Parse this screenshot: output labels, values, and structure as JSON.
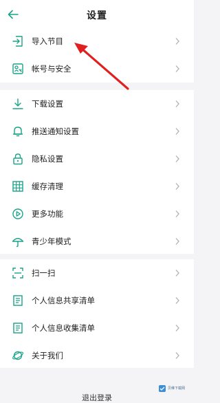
{
  "header": {
    "title": "设置",
    "back_icon": "back-arrow-icon"
  },
  "colors": {
    "accent": "#1aa38a",
    "annotation": "#e02020",
    "chevron": "#b0b0b0"
  },
  "groups": [
    {
      "items": [
        {
          "label": "导入节目",
          "icon": "import-icon"
        },
        {
          "label": "帐号与安全",
          "icon": "account-security-icon"
        }
      ]
    },
    {
      "items": [
        {
          "label": "下载设置",
          "icon": "download-icon"
        },
        {
          "label": "推送通知设置",
          "icon": "bell-icon"
        },
        {
          "label": "隐私设置",
          "icon": "lock-icon"
        },
        {
          "label": "缓存清理",
          "icon": "grid-icon"
        },
        {
          "label": "更多功能",
          "icon": "play-circle-icon"
        },
        {
          "label": "青少年模式",
          "icon": "umbrella-icon"
        }
      ]
    },
    {
      "items": [
        {
          "label": "扫一扫",
          "icon": "scan-icon"
        },
        {
          "label": "个人信息共享清单",
          "icon": "list-doc-icon"
        },
        {
          "label": "个人信息收集清单",
          "icon": "list-doc-icon"
        },
        {
          "label": "关于我们",
          "icon": "planet-icon"
        }
      ]
    }
  ],
  "bottom_partial_text": "退出登录",
  "watermark": {
    "line1": "贝维下载网"
  }
}
